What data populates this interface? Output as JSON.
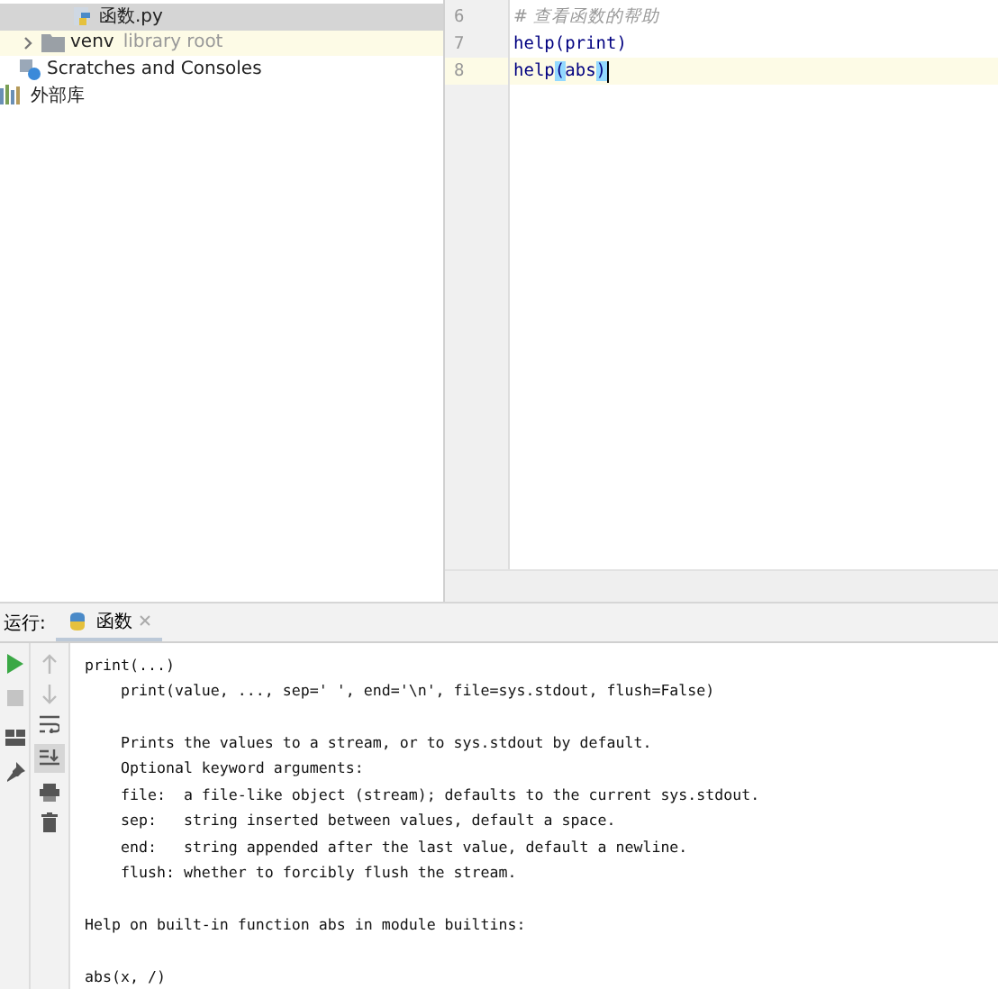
{
  "project_tree": {
    "items": [
      {
        "kind": "python-file",
        "label": "函数.py",
        "selected": true,
        "highlighted": false
      },
      {
        "kind": "folder",
        "label": "venv",
        "note": "library root",
        "selected": false,
        "highlighted": true
      },
      {
        "kind": "scratches",
        "label": "Scratches and Consoles",
        "selected": false,
        "highlighted": false
      },
      {
        "kind": "library",
        "label": "外部库",
        "selected": false,
        "highlighted": false
      }
    ]
  },
  "editor": {
    "lines": [
      {
        "number": "6",
        "current": false,
        "tokens": [
          {
            "kind": "comment",
            "text": "# 查看函数的帮助"
          }
        ]
      },
      {
        "number": "7",
        "current": false,
        "tokens": [
          {
            "kind": "call",
            "text": "help"
          },
          {
            "kind": "plain",
            "text": "("
          },
          {
            "kind": "plain",
            "text": "print"
          },
          {
            "kind": "plain",
            "text": ")"
          }
        ]
      },
      {
        "number": "8",
        "current": true,
        "tokens": [
          {
            "kind": "call",
            "text": "help"
          },
          {
            "kind": "match",
            "text": "("
          },
          {
            "kind": "plain",
            "text": "abs"
          },
          {
            "kind": "match",
            "text": ")"
          }
        ]
      }
    ]
  },
  "run_panel": {
    "label": "运行:",
    "tabs": [
      {
        "label": "函数",
        "selected": true
      }
    ],
    "output": [
      {
        "kind": "text",
        "text": "print(...)"
      },
      {
        "kind": "text",
        "text": "    print(value, ..., sep=' ', end='\\n', file=sys.stdout, flush=False)"
      },
      {
        "kind": "blank"
      },
      {
        "kind": "text",
        "text": "    Prints the values to a stream, or to sys.stdout by default."
      },
      {
        "kind": "text",
        "text": "    Optional keyword arguments:"
      },
      {
        "kind": "text",
        "text": "    file:  a file-like object (stream); defaults to the current sys.stdout."
      },
      {
        "kind": "text",
        "text": "    sep:   string inserted between values, default a space."
      },
      {
        "kind": "text",
        "text": "    end:   string appended after the last value, default a newline."
      },
      {
        "kind": "text",
        "text": "    flush: whether to forcibly flush the stream."
      },
      {
        "kind": "blank"
      },
      {
        "kind": "text",
        "text": "Help on built-in function abs in module builtins:"
      },
      {
        "kind": "blank"
      },
      {
        "kind": "text",
        "text": "abs(x, /)"
      }
    ]
  }
}
